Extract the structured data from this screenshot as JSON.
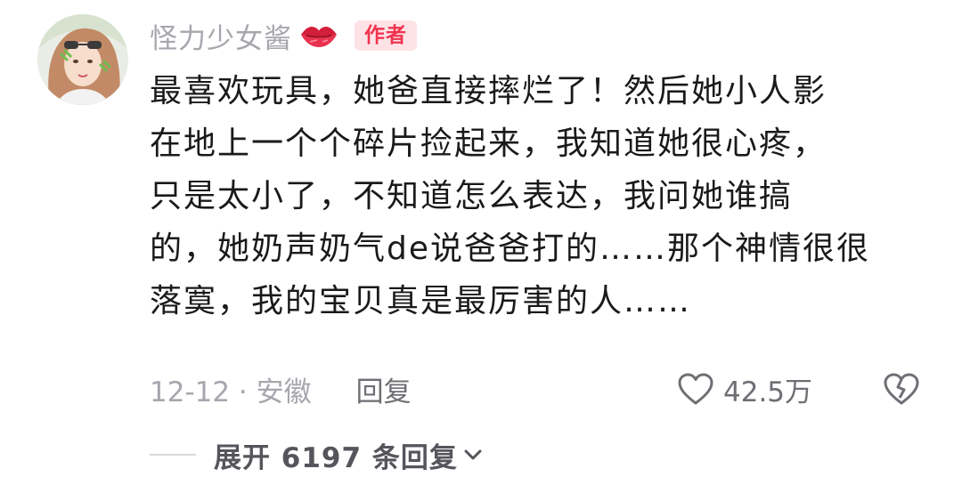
{
  "comment": {
    "username": "怪力少女酱",
    "author_badge": "作者",
    "text_lines": [
      "最喜欢玩具，她爸直接摔烂了！然后她小人影",
      "在地上一个个碎片捡起来，我知道她很心疼，",
      "只是太小了，不知道怎么表达，我问她谁搞",
      "的，她奶声奶气de说爸爸打的……那个神情很很",
      "落寞，我的宝贝真是最厉害的人……"
    ],
    "date_location": "12-12 · 安徽",
    "reply_label": "回复",
    "like_count": "42.5万",
    "expand_replies_label": "展开 6197 条回复"
  },
  "icons": {
    "avatar": "avatar-girl-photo",
    "name_decoration": "lips-icon",
    "like": "heart-outline-icon",
    "dislike": "broken-heart-icon",
    "expand": "chevron-down-icon"
  },
  "colors": {
    "username": "#a6a6ad",
    "badge_background": "#fde2e6",
    "badge_text": "#f0344f",
    "body_text": "#1a1a1a",
    "meta_text": "#a6a6ad",
    "action_text": "#6e6e74"
  }
}
